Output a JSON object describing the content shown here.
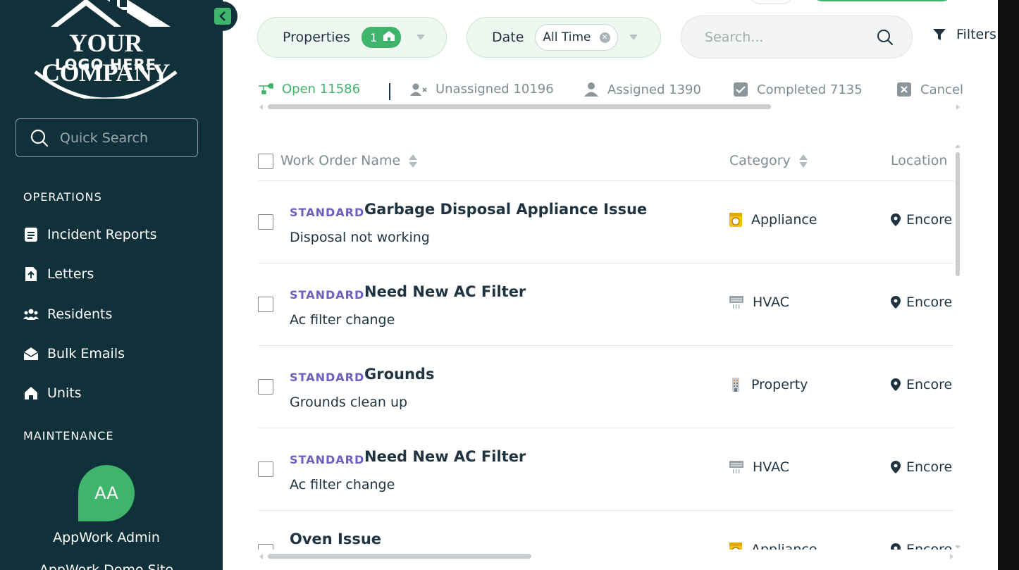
{
  "sidebar": {
    "logo_line1": "YOUR COMPANY",
    "logo_line2": "LOGO HERE",
    "quick_search_placeholder": "Quick Search",
    "section_operations": "OPERATIONS",
    "operations_items": [
      {
        "label": "Incident Reports",
        "icon": "document-icon"
      },
      {
        "label": "Letters",
        "icon": "file-upload-icon"
      },
      {
        "label": "Residents",
        "icon": "users-icon"
      },
      {
        "label": "Bulk Emails",
        "icon": "envelope-open-icon"
      },
      {
        "label": "Units",
        "icon": "house-icon"
      }
    ],
    "section_maintenance": "MAINTENANCE",
    "user": {
      "initials": "AA",
      "name": "AppWork Admin",
      "subtitle": "AppWork Demo Site"
    }
  },
  "filters_bar": {
    "properties_label": "Properties",
    "properties_count": "1",
    "date_label": "Date",
    "date_value": "All Time",
    "search_placeholder": "Search...",
    "filters_label": "Filters"
  },
  "status_tabs": [
    {
      "label": "Open 11586",
      "icon": "wrench-icon",
      "active": true
    },
    {
      "label": "Unassigned 10196",
      "icon": "user-x-icon",
      "active": false
    },
    {
      "label": "Assigned 1390",
      "icon": "user-icon",
      "active": false
    },
    {
      "label": "Completed 7135",
      "icon": "check-square-icon",
      "active": false
    },
    {
      "label": "Cancelled",
      "icon": "x-square-icon",
      "active": false
    }
  ],
  "table": {
    "headers": {
      "name": "Work Order Name",
      "category": "Category",
      "location": "Location"
    },
    "rows": [
      {
        "type": "STANDARD",
        "title": "Garbage Disposal Appliance Issue",
        "desc": "Disposal not working",
        "category": "Appliance",
        "category_icon": "appliance-icon",
        "location": "Encore"
      },
      {
        "type": "STANDARD",
        "title": "Need New AC Filter",
        "desc": "Ac filter change",
        "category": "HVAC",
        "category_icon": "hvac-icon",
        "location": "Encore"
      },
      {
        "type": "STANDARD",
        "title": "Grounds",
        "desc": "Grounds clean up",
        "category": "Property",
        "category_icon": "building-icon",
        "location": "Encore"
      },
      {
        "type": "STANDARD",
        "title": "Need New AC Filter",
        "desc": "Ac filter change",
        "category": "HVAC",
        "category_icon": "hvac-icon",
        "location": "Encore"
      },
      {
        "type": "",
        "title": "Oven Issue",
        "desc": "",
        "category": "Appliance",
        "category_icon": "appliance-icon",
        "location": "Encore"
      }
    ]
  },
  "colors": {
    "sidebar_bg": "#11313a",
    "accent": "#3fb56b",
    "type_label": "#6c5fc0"
  }
}
